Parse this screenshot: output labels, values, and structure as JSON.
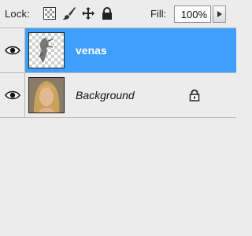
{
  "toolbar": {
    "lock_label": "Lock:",
    "lock_icons": [
      "lock-transparent-pixels-icon",
      "lock-image-pixels-icon",
      "lock-position-icon",
      "lock-all-icon"
    ],
    "fill_label": "Fill:",
    "fill_value": "100%"
  },
  "layers": [
    {
      "name": "venas",
      "selected": true,
      "visible": true,
      "locked": false,
      "thumbnail": "transparent-with-veins"
    },
    {
      "name": "Background",
      "selected": false,
      "visible": true,
      "locked": true,
      "thumbnail": "portrait-photo"
    }
  ],
  "colors": {
    "selection": "#3f9fff",
    "panel_bg": "#ececec",
    "divider": "#b9b9b9"
  }
}
